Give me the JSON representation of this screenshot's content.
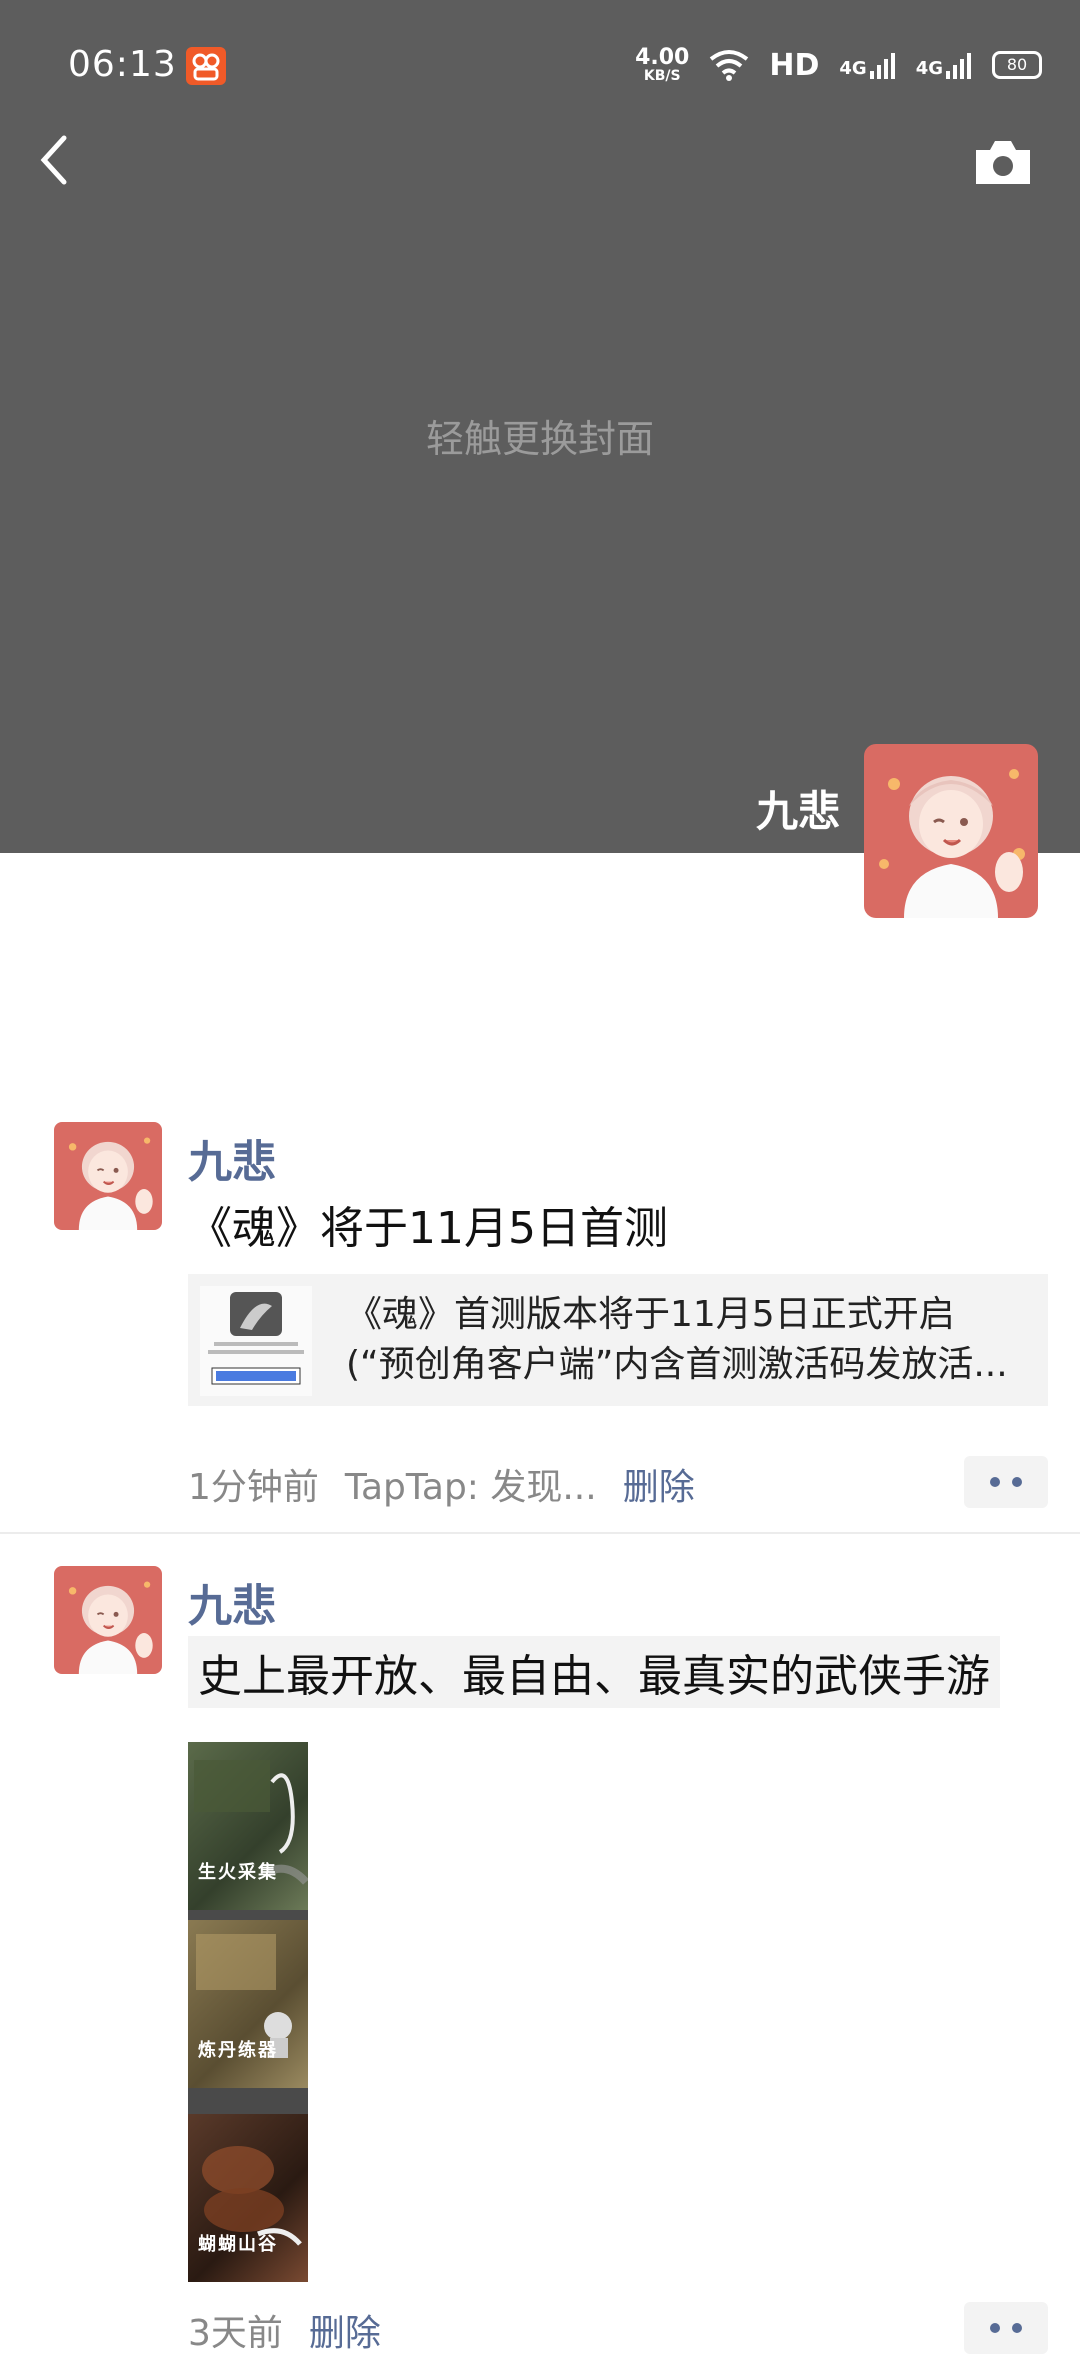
{
  "status_bar": {
    "time": "06:13",
    "net_speed_value": "4.00",
    "net_speed_unit": "KB/S",
    "hd_label": "HD",
    "signal1": "4G",
    "signal2": "4G",
    "battery": "80"
  },
  "cover": {
    "hint": "轻触更换封面",
    "owner_name": "九悲"
  },
  "posts": [
    {
      "author": "九悲",
      "text": "《魂》将于11月5日首测",
      "link_title_line1": "《魂》首测版本将于11月5日正式开启",
      "link_title_line2": "(“预创角客户端”内含首测激活码发放活...",
      "time": "1分钟前",
      "source": "TapTap: 发现...",
      "delete": "删除"
    },
    {
      "author": "九悲",
      "text": "史上最开放、最自由、最真实的武侠手游",
      "photo_captions": [
        "生火采集",
        "炼丹练器",
        "蝴蝴山谷"
      ],
      "time": "3天前",
      "delete": "删除"
    }
  ],
  "colors": {
    "cover_bg": "#5d5d5d",
    "link_blue": "#576b95",
    "avatar_bg": "#d96b63"
  }
}
